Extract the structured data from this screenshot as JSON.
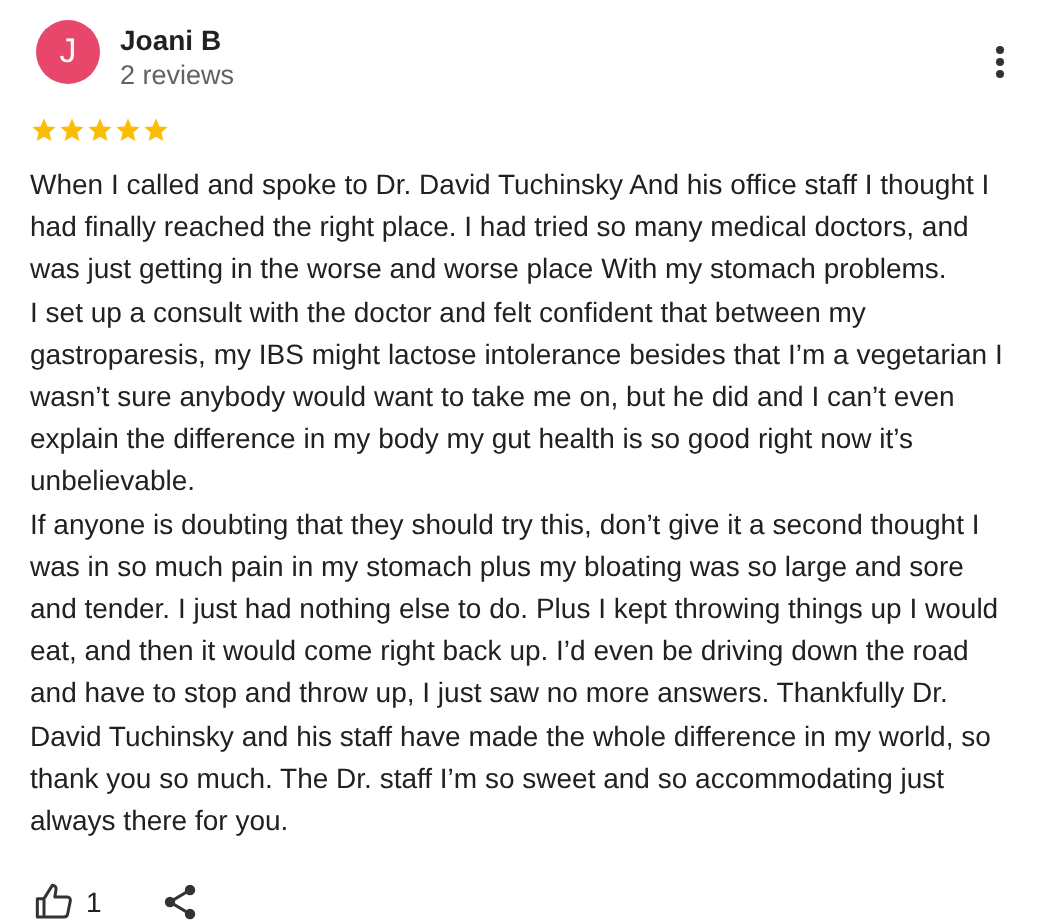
{
  "reviewer": {
    "avatar_letter": "J",
    "name": "Joani B",
    "review_count": "2 reviews"
  },
  "stars": 5,
  "review": [
    "When I called and spoke to Dr. David Tuchinsky And his office staff I thought I had finally reached the right place. I had tried so many medical doctors, and was just getting in the worse and worse place With my stomach problems.",
    "I set up a consult with the doctor and felt confident that between my gastroparesis, my IBS might lactose intolerance besides that I’m a vegetarian I wasn’t sure anybody would want to take me on, but he did and I can’t even explain the difference in my body my gut health is so good right now it’s unbelievable.",
    "If anyone is doubting that they should try this, don’t give it a second thought I was in so much pain in my stomach plus my bloating was so large and sore and tender. I just had nothing else to do. Plus I kept throwing things up I would eat, and then it would come right back up. I’d even be driving down the road and have to stop and throw up, I just saw no more answers. Thankfully Dr. David Tuchinsky and his staff have made the whole difference in my world, so thank you so much. The Dr. staff I’m so sweet and so accommodating just always there for you."
  ],
  "likes": "1"
}
